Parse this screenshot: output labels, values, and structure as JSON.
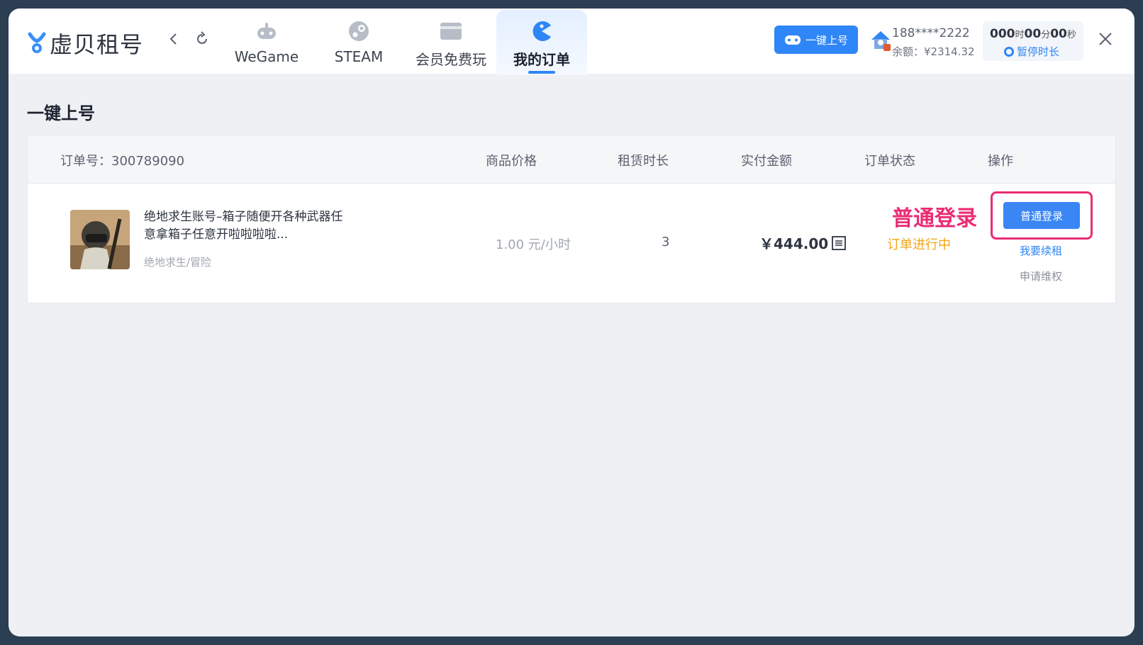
{
  "app": {
    "logo_text": "虚贝租号"
  },
  "tabs": [
    {
      "label": "WeGame",
      "icon": "gamepad-icon"
    },
    {
      "label": "STEAM",
      "icon": "steam-icon"
    },
    {
      "label": "会员免费玩",
      "icon": "card-icon"
    },
    {
      "label": "我的订单",
      "icon": "pacman-order-icon",
      "active": true
    }
  ],
  "header": {
    "quick_login_label": "一键上号",
    "user_phone": "188****2222",
    "user_balance": "余额：¥2314.32",
    "timer": {
      "h": "000",
      "h_unit": "时",
      "m": "00",
      "m_unit": "分",
      "s": "00",
      "s_unit": "秒"
    },
    "pause_label": "暂停时长"
  },
  "page": {
    "title": "一键上号"
  },
  "table": {
    "order_no": "订单号：300789090",
    "headers": {
      "price": "商品价格",
      "duration": "租赁时长",
      "paid": "实付金额",
      "status": "订单状态",
      "action": "操作"
    },
    "row": {
      "title": "绝地求生账号–箱子随便开各种武器任意拿箱子任意开啦啦啦啦...",
      "category": "绝地求生/冒险",
      "price": "1.00 元/小时",
      "duration": "3",
      "paid": "￥444.00",
      "status": "订单进行中",
      "annotation": "普通登录",
      "login_label": "普通登录",
      "renew_label": "我要续租",
      "claim_label": "申请维权"
    }
  },
  "colors": {
    "accent": "#2f86f6",
    "annotation": "#ea2c73",
    "status": "#f2a416"
  }
}
